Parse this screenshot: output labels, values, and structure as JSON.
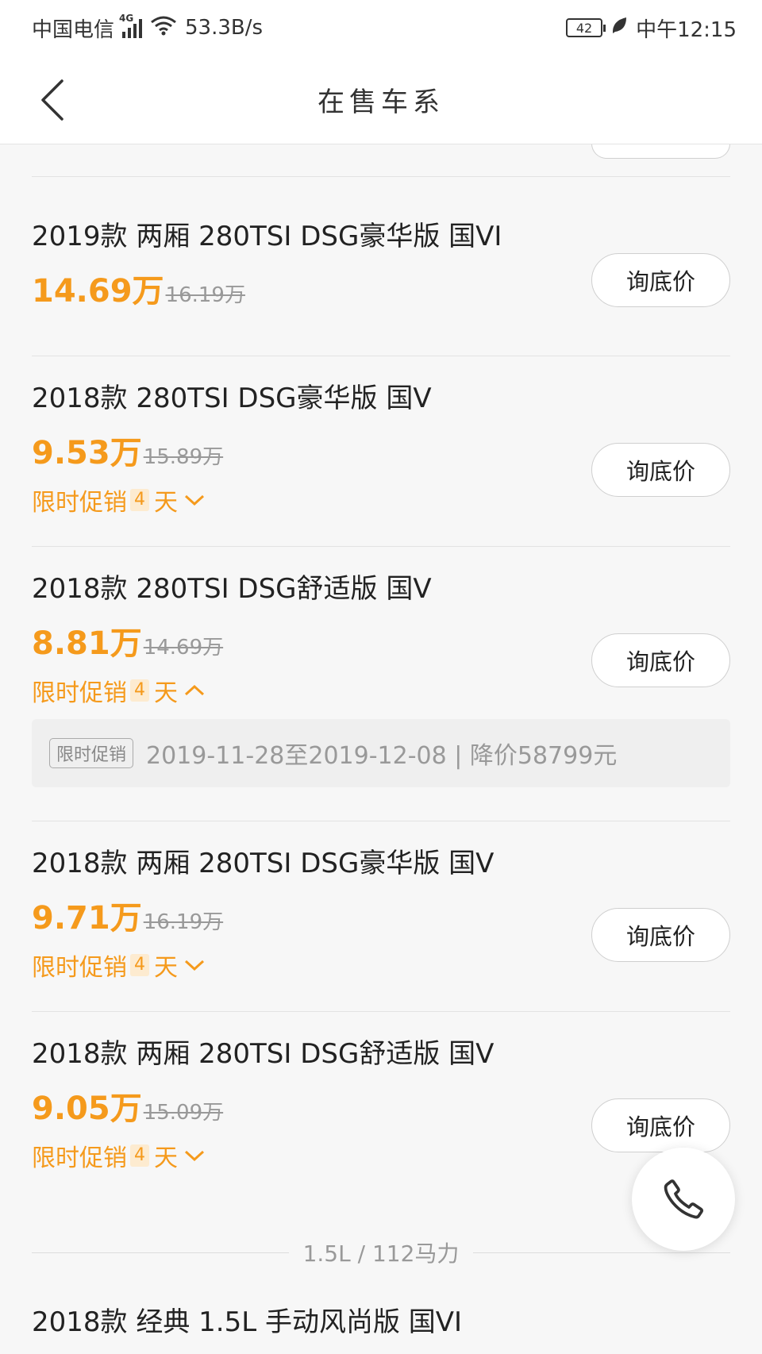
{
  "status_bar": {
    "carrier": "中国电信",
    "network": "4G",
    "speed": "53.3B/s",
    "battery": "42",
    "time": "中午12:15"
  },
  "nav": {
    "title": "在售车系"
  },
  "cars": [
    {
      "name": "2019款 两厢 280TSI DSG豪华版 国VI",
      "price": "14.69万",
      "original_price": "16.19万",
      "button": "询底价"
    },
    {
      "name": "2018款 280TSI DSG豪华版 国V",
      "price": "9.53万",
      "original_price": "15.89万",
      "promo_label": "限时促销",
      "promo_days": "4",
      "promo_unit": "天",
      "button": "询底价"
    },
    {
      "name": "2018款 280TSI DSG舒适版 国V",
      "price": "8.81万",
      "original_price": "14.69万",
      "promo_label": "限时促销",
      "promo_days": "4",
      "promo_unit": "天",
      "button": "询底价",
      "promo_detail": {
        "tag": "限时促销",
        "text": "2019-11-28至2019-12-08 | 降价58799元"
      }
    },
    {
      "name": "2018款 两厢 280TSI DSG豪华版 国V",
      "price": "9.71万",
      "original_price": "16.19万",
      "promo_label": "限时促销",
      "promo_days": "4",
      "promo_unit": "天",
      "button": "询底价"
    },
    {
      "name": "2018款 两厢 280TSI DSG舒适版 国V",
      "price": "9.05万",
      "original_price": "15.09万",
      "promo_label": "限时促销",
      "promo_days": "4",
      "promo_unit": "天",
      "button": "询底价"
    },
    {
      "name": "2018款 经典 1.5L 手动风尚版 国VI"
    }
  ],
  "section": {
    "label": "1.5L / 112马力"
  },
  "icons": {
    "back": "chevron-left-icon",
    "call": "phone-icon"
  },
  "colors": {
    "accent": "#f59a1c",
    "background": "#f7f7f7"
  }
}
